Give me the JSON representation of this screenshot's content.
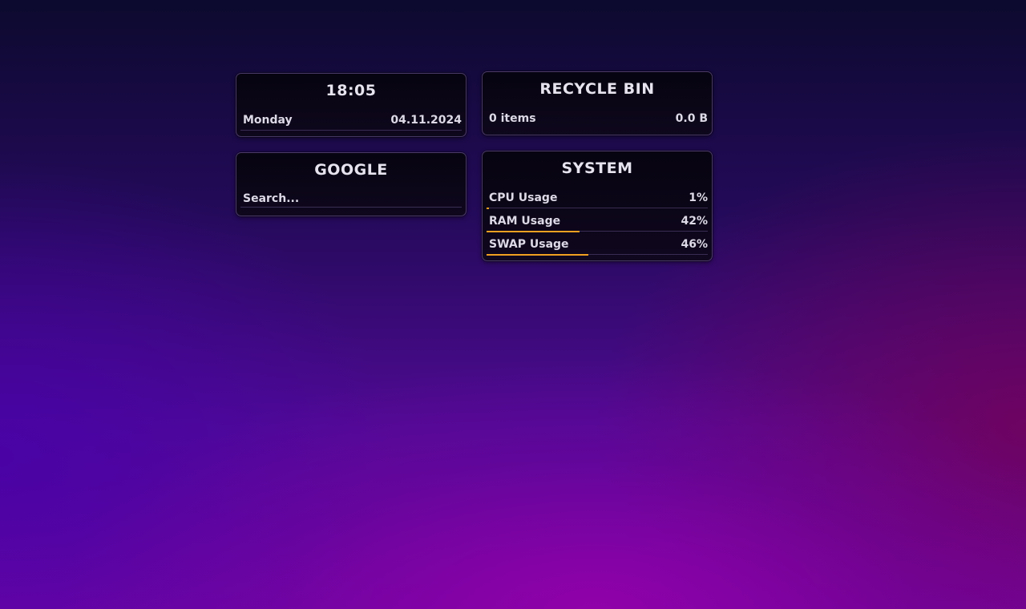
{
  "colors": {
    "accent": "#f0a020",
    "widget_bg": "#0a0614",
    "text": "#e6e3ee"
  },
  "clock": {
    "time": "18:05",
    "weekday": "Monday",
    "date": "04.11.2024"
  },
  "recycle_bin": {
    "title": "RECYCLE BIN",
    "items": "0 items",
    "size": "0.0 B"
  },
  "google": {
    "title": "GOOGLE",
    "placeholder": "Search..."
  },
  "system": {
    "title": "SYSTEM",
    "metrics": [
      {
        "label": "CPU Usage",
        "value": "1%",
        "fraction": 0.01
      },
      {
        "label": "RAM Usage",
        "value": "42%",
        "fraction": 0.42
      },
      {
        "label": "SWAP Usage",
        "value": "46%",
        "fraction": 0.46
      }
    ]
  }
}
